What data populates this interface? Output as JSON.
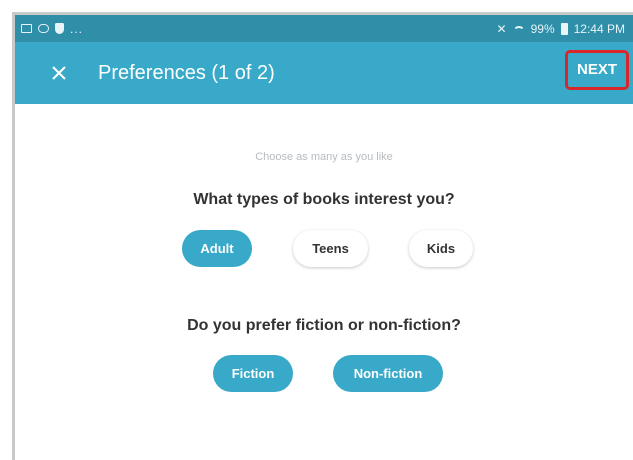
{
  "status_bar": {
    "left_icons": [
      "gallery-icon",
      "chat-icon",
      "shield-icon"
    ],
    "more": "...",
    "battery": "99%",
    "time": "12:44 PM"
  },
  "toolbar": {
    "title": "Preferences (1 of 2)",
    "close_icon": "close-icon",
    "next_label": "NEXT"
  },
  "content": {
    "hint": "Choose as many as you like",
    "question1": "What types of books interest you?",
    "q1_options": [
      {
        "label": "Adult",
        "selected": true
      },
      {
        "label": "Teens",
        "selected": false
      },
      {
        "label": "Kids",
        "selected": false
      }
    ],
    "question2": "Do you prefer fiction or non-fiction?",
    "q2_options": [
      {
        "label": "Fiction",
        "selected": true
      },
      {
        "label": "Non-fiction",
        "selected": true
      }
    ]
  },
  "colors": {
    "status_bar": "#2f8ea8",
    "toolbar": "#38a9c9",
    "accent": "#38a9c9",
    "highlight_box": "#d9262a"
  }
}
